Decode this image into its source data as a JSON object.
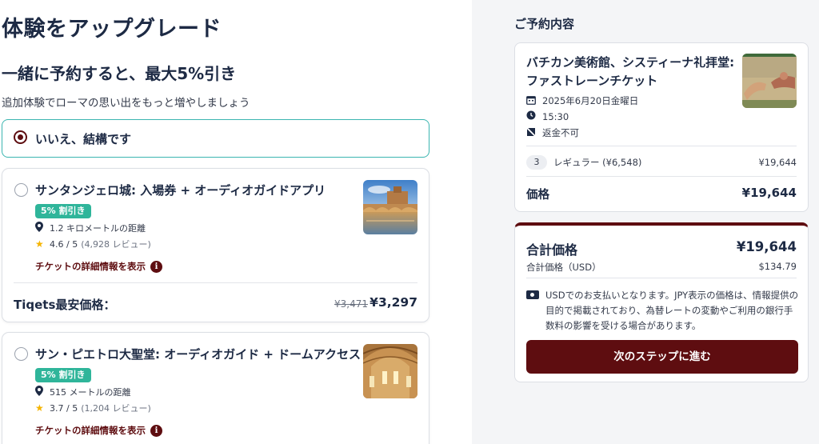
{
  "upgrade": {
    "title": "体験をアップグレード",
    "subtitle": "一緒に予約すると、最大5%引き",
    "description": "追加体験でローマの思い出をもっと増やしましょう",
    "decline_label": "いいえ、結構です"
  },
  "offers": [
    {
      "title": "サンタンジェロ城: 入場券 + オーディオガイドアプリ",
      "badge": "5% 割引き",
      "distance": "1.2 キロメートルの距離",
      "rating": "4.6 / 5",
      "reviews": "(4,928 レビュー)",
      "details_link": "チケットの詳細情報を表示",
      "price_label": "Tiqets最安価格：",
      "old_price": "¥3,471",
      "new_price": "¥3,297"
    },
    {
      "title": "サン・ピエトロ大聖堂: オーディオガイド + ドームアクセス",
      "badge": "5% 割引き",
      "distance": "515 メートルの距離",
      "rating": "3.7 / 5",
      "reviews": "(1,204 レビュー)",
      "details_link": "チケットの詳細情報を表示"
    }
  ],
  "summary": {
    "heading": "ご予約内容",
    "title": "バチカン美術館、システィーナ礼拝堂: ファストレーンチケット",
    "date": "2025年6月20日金曜日",
    "time": "15:30",
    "refund": "返金不可",
    "quantity": "3",
    "ticket_type": "レギュラー (¥6,548)",
    "line_amount": "¥19,644",
    "price_label": "価格",
    "price": "¥19,644"
  },
  "total": {
    "label": "合計価格",
    "amount": "¥19,644",
    "usd_label": "合計価格（USD）",
    "usd_amount": "$134.79",
    "notice": "USDでのお支払いとなります。JPY表示の価格は、情報提供の目的で掲載されており、為替レートの変動やご利用の銀行手数料の影響を受ける場合があります。",
    "cta": "次のステップに進む"
  },
  "colors": {
    "brand": "#5e0d10",
    "accent_teal": "#3bb5b0",
    "badge_green": "#2fb59a",
    "star": "#f5b400"
  },
  "icons": [
    "radio-selected-icon",
    "radio-icon",
    "location-pin-icon",
    "star-icon",
    "info-icon",
    "calendar-icon",
    "clock-icon",
    "no-refund-icon",
    "money-icon"
  ]
}
